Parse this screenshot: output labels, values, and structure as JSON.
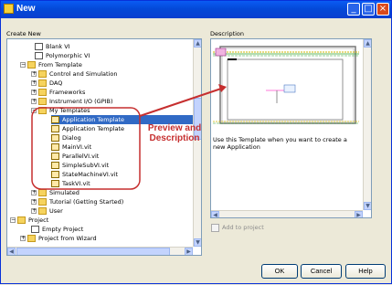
{
  "window": {
    "title": "New"
  },
  "labels": {
    "create_new": "Create New",
    "description": "Description",
    "add_to_project": "Add to project",
    "description_text": "Use this Template when you want to create a new Application"
  },
  "tree": {
    "items": [
      {
        "label": "Blank VI"
      },
      {
        "label": "Polymorphic VI"
      },
      {
        "label": "From Template"
      },
      {
        "label": "Control and Simulation"
      },
      {
        "label": "DAQ"
      },
      {
        "label": "Frameworks"
      },
      {
        "label": "Instrument I/O (GPIB)"
      },
      {
        "label": "My Templates"
      },
      {
        "label": "Application Template"
      },
      {
        "label": "Application Template"
      },
      {
        "label": "Dialog"
      },
      {
        "label": "MainVI.vit"
      },
      {
        "label": "ParallelVI.vit"
      },
      {
        "label": "SimpleSubVI.vit"
      },
      {
        "label": "StateMachineVI.vit"
      },
      {
        "label": "TaskVI.vit"
      },
      {
        "label": "Simulated"
      },
      {
        "label": "Tutorial (Getting Started)"
      },
      {
        "label": "User"
      },
      {
        "label": "Project"
      },
      {
        "label": "Empty Project"
      },
      {
        "label": "Project from Wizard"
      }
    ]
  },
  "annotation": {
    "line1": "Preview and",
    "line2": "Description"
  },
  "buttons": {
    "ok": "OK",
    "cancel": "Cancel",
    "help": "Help"
  },
  "colors": {
    "accent": "#316ac5",
    "callout": "#c62f2f",
    "titlebar": "#0a5cf4"
  }
}
